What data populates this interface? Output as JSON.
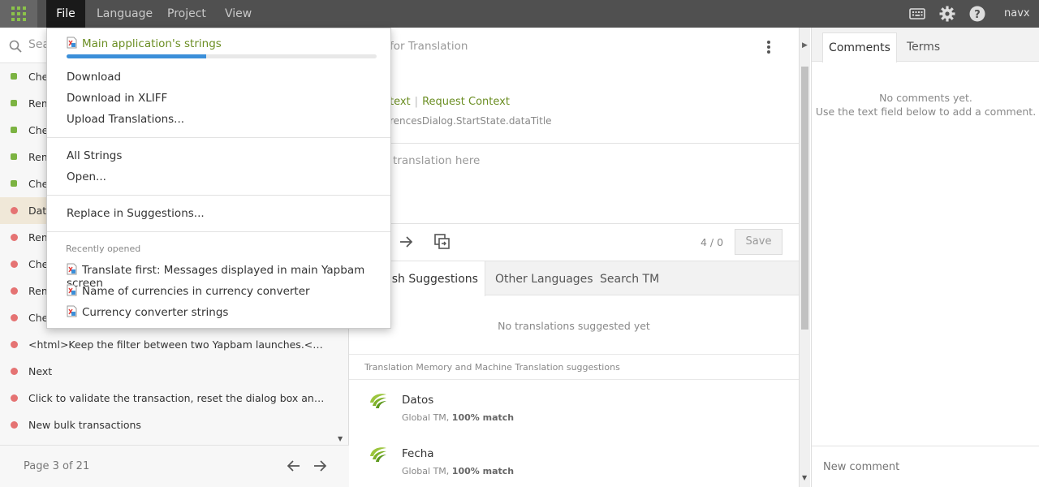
{
  "topbar": {
    "menus": [
      "File",
      "Language",
      "Project",
      "View"
    ],
    "user": "navx",
    "icons": [
      "apps-grid-icon",
      "keyboard-icon",
      "gear-icon",
      "help-icon"
    ]
  },
  "left": {
    "search_placeholder": "Sea",
    "strings": [
      {
        "text": "Che",
        "status": "green"
      },
      {
        "text": "Rem",
        "status": "green"
      },
      {
        "text": "Che",
        "status": "green"
      },
      {
        "text": "Rem",
        "status": "green"
      },
      {
        "text": "Che",
        "status": "green"
      },
      {
        "text": "Data",
        "status": "red",
        "selected": true
      },
      {
        "text": "Rem",
        "status": "red"
      },
      {
        "text": "Che",
        "status": "red"
      },
      {
        "text": "Rem",
        "status": "red"
      },
      {
        "text": "Che",
        "status": "red"
      },
      {
        "text": "<html>Keep the filter between two Yapbam launches.<hr style...",
        "status": "red"
      },
      {
        "text": "Next",
        "status": "red"
      },
      {
        "text": "Click to validate the transaction, reset the dialog box and then ...",
        "status": "red"
      },
      {
        "text": "New bulk transactions",
        "status": "red"
      }
    ],
    "page_text": "Page 3 of 21"
  },
  "center": {
    "title": "for Translation",
    "context_link1": "text",
    "context_link2": "Request Context",
    "context_separator": "|",
    "key": "rencesDialog.StartState.dataTitle",
    "translation_placeholder": "translation here",
    "counter": "4 / 0",
    "save_label": "Save",
    "tabs": [
      "nish Suggestions",
      "Other Languages",
      "Search TM"
    ],
    "no_suggestions": "No translations suggested yet",
    "tm_header": "Translation Memory and Machine Translation suggestions",
    "tm": [
      {
        "text": "Datos",
        "source": "Global TM, ",
        "match": "100% match"
      },
      {
        "text": "Fecha",
        "source": "Global TM, ",
        "match": "100% match"
      }
    ]
  },
  "right": {
    "tabs": [
      "Comments",
      "Terms"
    ],
    "no_comments_line1": "No comments yet.",
    "no_comments_line2": "Use the text field below to add a comment.",
    "new_comment_placeholder": "New comment"
  },
  "file_menu": {
    "current_file": "Main application's strings",
    "progress": 0.45,
    "items": [
      "Download",
      "Download in XLIFF",
      "Upload Translations..."
    ],
    "items2": [
      "All Strings",
      "Open..."
    ],
    "items3": [
      "Replace in Suggestions..."
    ],
    "recent_label": "Recently opened",
    "recent": [
      "Translate first: Messages displayed in main Yapbam screen",
      "Name of currencies in currency converter",
      "Currency converter strings"
    ]
  },
  "colors": {
    "accent_green": "#6b8e23",
    "progress_blue": "#3b8fd9",
    "status_green": "#7cb342",
    "status_red": "#e57373"
  }
}
